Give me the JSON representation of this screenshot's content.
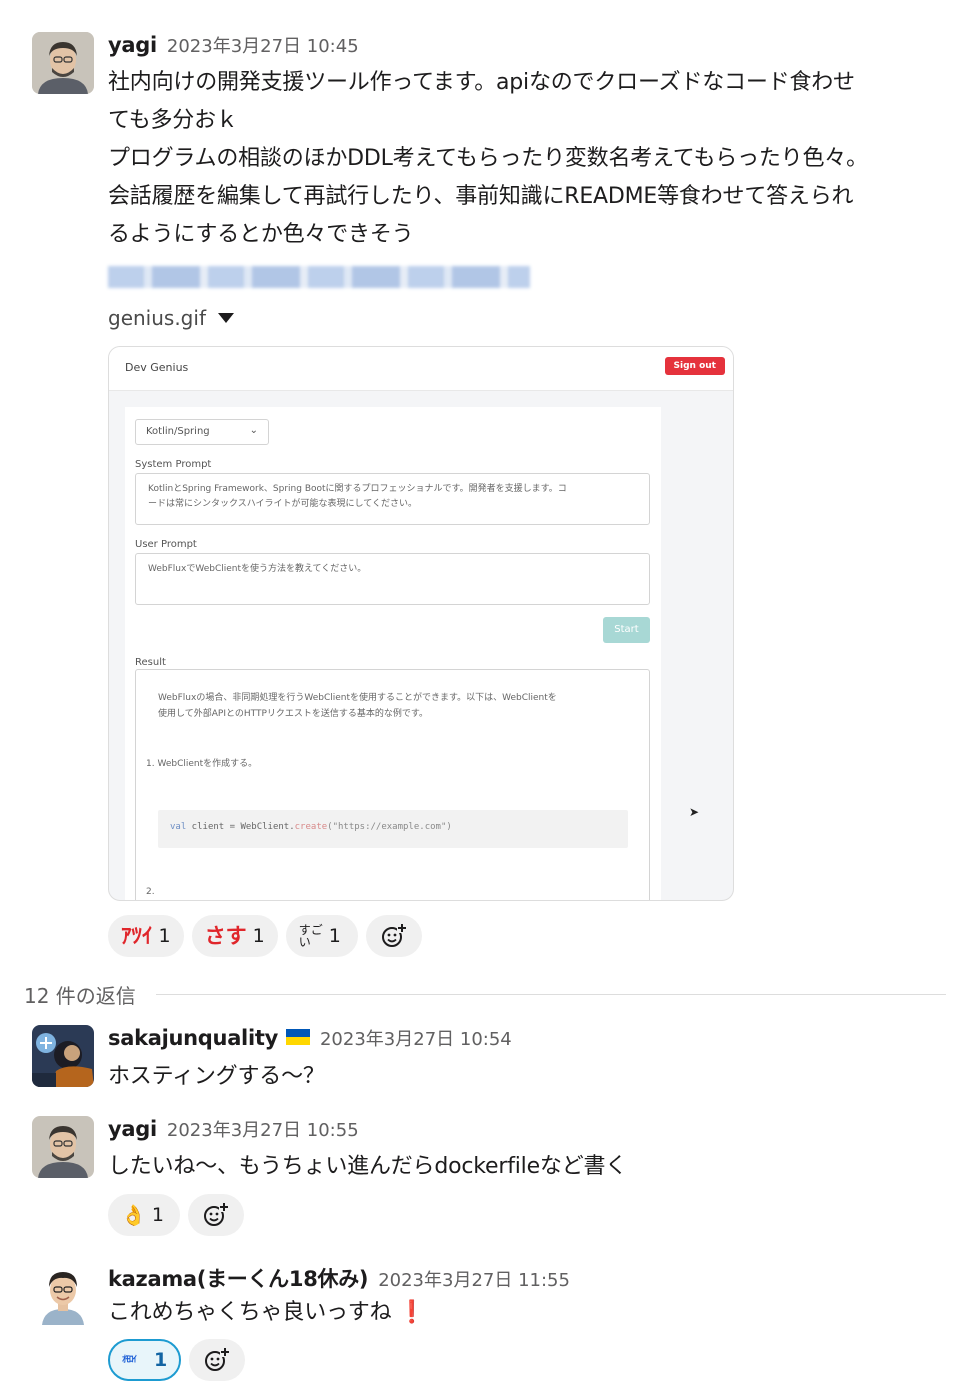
{
  "messages": [
    {
      "author": "yagi",
      "timestamp": "2023年3月27日 10:45",
      "lines": [
        "社内向けの開発支援ツール作ってます。apiなのでクローズドなコード食わせ",
        "ても多分おｋ",
        "プログラムの相談のほかDDL考えてもらったり変数名考えてもらったり色々。",
        "会話履歴を編集して再試行したり、事前知識にREADME等食わせて答えられ",
        "るようにするとか色々できそう"
      ],
      "attachment": {
        "filename": "genius.gif",
        "app": {
          "title": "Dev Genius",
          "signout": "Sign out",
          "select_value": "Kotlin/Spring",
          "system_prompt_label": "System Prompt",
          "system_prompt_lines": [
            "KotlinとSpring Framework、Spring Bootに関するプロフェッショナルです。開発者を支援します。コ",
            "ードは常にシンタックスハイライトが可能な表現にしてください。"
          ],
          "user_prompt_label": "User Prompt",
          "user_prompt": "WebFluxでWebClientを使う方法を教えてください。",
          "start_label": "Start",
          "result_label": "Result",
          "result_lines": [
            "WebFluxの場合、非同期処理を行うWebClientを使用することができます。以下は、WebClientを",
            "使用して外部APIとのHTTPリクエストを送信する基本的な例です。"
          ],
          "step1": "1. WebClientを作成する。",
          "code_kw": "val",
          "code_var": " client = WebClient.",
          "code_fn": "create",
          "code_str": "(\"https://example.com\")",
          "step2": "2."
        }
      },
      "reactions": [
        {
          "emoji": "ｱﾂｲ",
          "count": "1"
        },
        {
          "emoji": "さす",
          "count": "1"
        },
        {
          "emoji": "すご い",
          "count": "1"
        }
      ]
    }
  ],
  "thread": {
    "replies_label": "12 件の返信",
    "replies": [
      {
        "author": "sakajunquality",
        "timestamp": "2023年3月27日 10:54",
        "text": "ホスティングする〜？"
      },
      {
        "author": "yagi",
        "timestamp": "2023年3月27日 10:55",
        "text": "したいね〜、もうちょい進んだらdockerfileなど書く",
        "reactions": [
          {
            "emoji": "👌",
            "count": "1"
          }
        ]
      },
      {
        "author": "kazama(まーくん18休み)",
        "timestamp": "2023年3月27日 11:55",
        "text": "これめちゃくちゃ良いっすね",
        "exclamation": "❗",
        "reactions": [
          {
            "emoji": "ｵﾓﾛｲ",
            "count": "1"
          }
        ]
      }
    ]
  },
  "colors": {
    "text": "#1d1c1d",
    "muted": "#616061",
    "accent_blue": "#1d9bd1",
    "reaction_bg": "#f0f0f0",
    "signout_red": "#e5323c",
    "start_teal": "#a8d8d5"
  }
}
